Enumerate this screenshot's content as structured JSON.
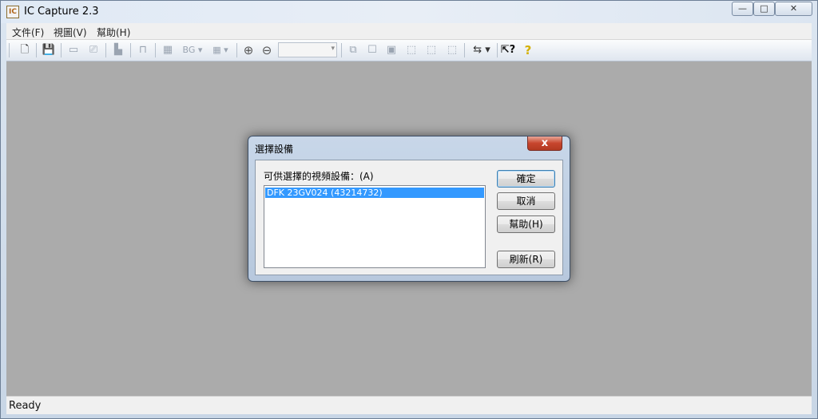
{
  "window": {
    "title": "IC Capture 2.3",
    "icon_text": "IC"
  },
  "caption_buttons": {
    "minimize": "—",
    "maximize": "□",
    "close": "✕"
  },
  "menu": {
    "items": [
      "文件(F)",
      "視圖(V)",
      "幫助(H)"
    ]
  },
  "toolbar": {
    "new": "🗋",
    "save": "💾",
    "record": "▭",
    "snapshot": "⎚",
    "histogram": "▙",
    "trigger": "⊓",
    "format": "▦",
    "bg": "BG ▾",
    "grid": "▦ ▾",
    "zoom_in": "⊕",
    "zoom_out": "⊖",
    "zoom_value": "",
    "zoom_arrow": "▾",
    "b1": "⧉",
    "b2": "☐",
    "b3": "▣",
    "b4": "⬚",
    "b5": "⬚",
    "b6": "⬚",
    "usb": "⇆ ▾",
    "whatsthis": "⇱?",
    "help": "?"
  },
  "status": {
    "text": "Ready"
  },
  "dialog": {
    "title": "選擇設備",
    "close": "x",
    "list_label": "可供選擇的視頻設備：(A)",
    "devices": [
      "DFK 23GV024 (43214732)"
    ],
    "buttons": {
      "ok": "確定",
      "cancel": "取消",
      "help": "幫助(H)",
      "refresh": "刷新(R)"
    }
  },
  "colors": {
    "selection": "#3399ff",
    "client_bg": "#ababab",
    "close_red": "#c7452d"
  }
}
